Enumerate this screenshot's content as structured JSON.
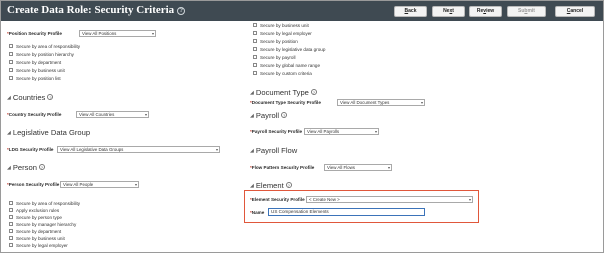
{
  "header": {
    "title": "Create Data Role: Security Criteria",
    "buttons": {
      "back": {
        "pre": "",
        "ul": "B",
        "post": "ack"
      },
      "next": {
        "pre": "Ne",
        "ul": "x",
        "post": "t"
      },
      "review": {
        "pre": "Re",
        "ul": "v",
        "post": "iew"
      },
      "submit": {
        "pre": "Su",
        "ul": "b",
        "post": "mit"
      },
      "cancel": {
        "pre": "",
        "ul": "C",
        "post": "ancel"
      }
    }
  },
  "left": {
    "position_profile": {
      "label": "Position Security Profile",
      "value": "View All Positions"
    },
    "position_checks": [
      "Secure by area of responsibility",
      "Secure by position hierarchy",
      "Secure by department",
      "Secure by business unit",
      "Secure by position list"
    ],
    "countries": {
      "heading": "Countries",
      "label": "Country Security Profile",
      "value": "View All Countries"
    },
    "ldg": {
      "heading": "Legislative Data Group",
      "label": "LDG Security Profile",
      "value": "View All Legislative Data Groups"
    },
    "person": {
      "heading": "Person",
      "label": "Person Security Profile",
      "value": "View All People"
    },
    "person_checks": [
      "Secure by area of responsibility",
      "Apply exclusion rules",
      "Secure by person type",
      "Secure by manager hierarchy",
      "Secure by department",
      "Secure by business unit",
      "Secure by legal employer"
    ]
  },
  "right": {
    "top_checks": [
      "Secure by business unit",
      "Secure by legal employer",
      "Secure by position",
      "Secure by legislative data group",
      "Secure by payroll",
      "Secure by global name range",
      "Secure by custom criteria"
    ],
    "document_type": {
      "heading": "Document Type",
      "label": "Document Type Security Profile",
      "value": "View All Document Types"
    },
    "payroll": {
      "heading": "Payroll",
      "label": "Payroll Security Profile",
      "value": "View All Payrolls"
    },
    "payroll_flow": {
      "heading": "Payroll Flow",
      "label": "Flow Pattern Security Profile",
      "value": "View All Flows"
    },
    "element": {
      "heading": "Element",
      "label": "Element Security Profile",
      "value": "< Create New >",
      "name_label": "Name",
      "name_value": "US Compensation Elements"
    }
  },
  "colors": {
    "header_bg": "#3f4a52",
    "highlight": "#e0573b",
    "input_focus": "#3b73b9"
  }
}
